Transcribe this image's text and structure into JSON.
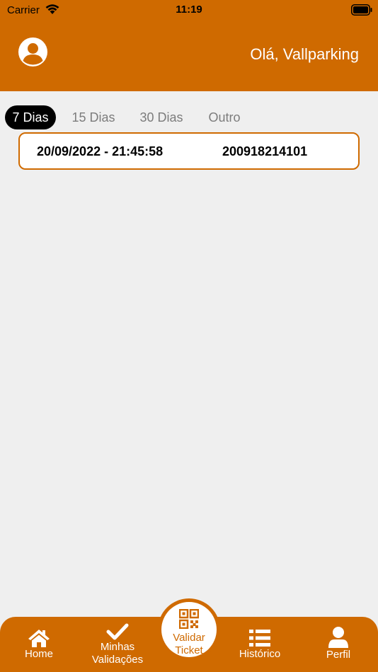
{
  "status_bar": {
    "carrier": "Carrier",
    "time": "11:19"
  },
  "header": {
    "greeting": "Olá, Vallparking"
  },
  "tabs": [
    {
      "label": "7 Dias",
      "active": true
    },
    {
      "label": "15 Dias",
      "active": false
    },
    {
      "label": "30 Dias",
      "active": false
    },
    {
      "label": "Outro",
      "active": false
    }
  ],
  "records": [
    {
      "datetime": "20/09/2022 - 21:45:58",
      "code": "200918214101"
    }
  ],
  "nav": {
    "home": "Home",
    "validations_line1": "Minhas",
    "validations_line2": "Validações",
    "validate_line1": "Validar",
    "validate_line2": "Ticket",
    "history": "Histórico",
    "profile": "Perfil"
  },
  "colors": {
    "accent": "#cf6a00",
    "background": "#efefef",
    "card": "#ffffff"
  }
}
